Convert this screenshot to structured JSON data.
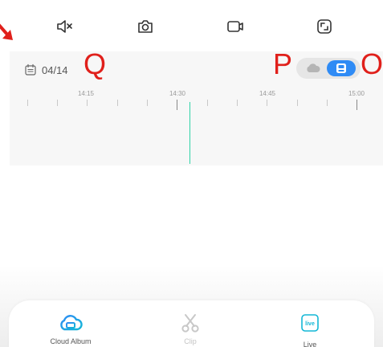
{
  "top_controls": [
    {
      "name": "mute-button",
      "icon": "speaker-muted-icon"
    },
    {
      "name": "snapshot-button",
      "icon": "camera-icon"
    },
    {
      "name": "record-button",
      "icon": "video-camera-icon"
    },
    {
      "name": "fullscreen-button",
      "icon": "expand-icon"
    }
  ],
  "timeline": {
    "date": "04/14",
    "time_labels": [
      "14:15",
      "14:30",
      "14:45",
      "15:00"
    ]
  },
  "storage_toggle": {
    "options": [
      "cloud",
      "local"
    ],
    "selected": "local"
  },
  "annotations": {
    "q": "Q",
    "p": "P",
    "o": "O"
  },
  "bottom_nav": {
    "cloud_album": "Cloud Album",
    "clip": "Clip",
    "live": "Live",
    "live_badge": "live"
  },
  "colors": {
    "accent_blue": "#2f8bf5",
    "cursor_green": "#2fd3a6",
    "annotation_red": "#e0201b",
    "live_cyan": "#13b7d6"
  }
}
